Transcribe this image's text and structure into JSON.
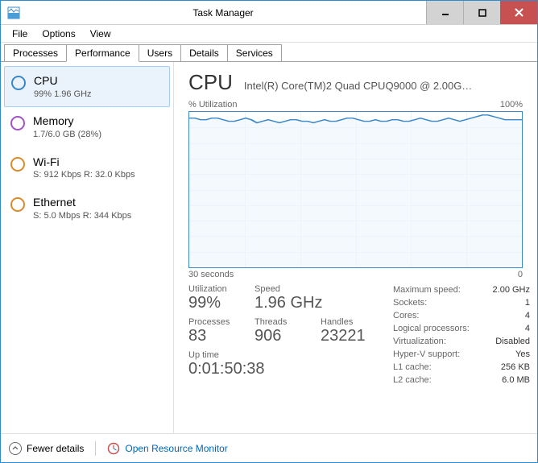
{
  "window": {
    "title": "Task Manager"
  },
  "menu": {
    "file": "File",
    "options": "Options",
    "view": "View"
  },
  "tabs": {
    "processes": "Processes",
    "performance": "Performance",
    "users": "Users",
    "details": "Details",
    "services": "Services"
  },
  "sidebar": {
    "cpu": {
      "label": "CPU",
      "sub": "99%  1.96 GHz"
    },
    "memory": {
      "label": "Memory",
      "sub": "1.7/6.0 GB (28%)"
    },
    "wifi": {
      "label": "Wi-Fi",
      "sub": "S: 912 Kbps R: 32.0 Kbps"
    },
    "ethernet": {
      "label": "Ethernet",
      "sub": "S: 5.0 Mbps R: 344 Kbps"
    }
  },
  "main": {
    "heading": "CPU",
    "description": "Intel(R) Core(TM)2 Quad CPUQ9000 @ 2.00G…",
    "chart_top_left": "% Utilization",
    "chart_top_right": "100%",
    "chart_bottom_left": "30 seconds",
    "chart_bottom_right": "0",
    "stats": {
      "utilization_label": "Utilization",
      "utilization": "99%",
      "speed_label": "Speed",
      "speed": "1.96 GHz",
      "processes_label": "Processes",
      "processes": "83",
      "threads_label": "Threads",
      "threads": "906",
      "handles_label": "Handles",
      "handles": "23221",
      "uptime_label": "Up time",
      "uptime": "0:01:50:38"
    },
    "right": {
      "maxspeed_l": "Maximum speed:",
      "maxspeed": "2.00 GHz",
      "sockets_l": "Sockets:",
      "sockets": "1",
      "cores_l": "Cores:",
      "cores": "4",
      "logical_l": "Logical processors:",
      "logical": "4",
      "virt_l": "Virtualization:",
      "virt": "Disabled",
      "hyperv_l": "Hyper-V support:",
      "hyperv": "Yes",
      "l1_l": "L1 cache:",
      "l1": "256 KB",
      "l2_l": "L2 cache:",
      "l2": "6.0 MB"
    }
  },
  "chart_data": {
    "type": "line",
    "title": "% Utilization",
    "xlabel": "",
    "ylabel": "",
    "x_range_label": "30 seconds",
    "ylim": [
      0,
      100
    ],
    "series": [
      {
        "name": "CPU %",
        "values": [
          96,
          96,
          95,
          95,
          96,
          96,
          95,
          94,
          94,
          95,
          96,
          95,
          93,
          94,
          95,
          94,
          93,
          94,
          95,
          95,
          94,
          94,
          93,
          94,
          95,
          94,
          94,
          95,
          96,
          96,
          95,
          94,
          94,
          95,
          94,
          94,
          95,
          95,
          94,
          94,
          95,
          96,
          95,
          94,
          94,
          95,
          96,
          95,
          94,
          95,
          96,
          97,
          98,
          98,
          97,
          96,
          95,
          95,
          95,
          95
        ]
      }
    ]
  },
  "footer": {
    "fewer": "Fewer details",
    "resmon": "Open Resource Monitor"
  }
}
